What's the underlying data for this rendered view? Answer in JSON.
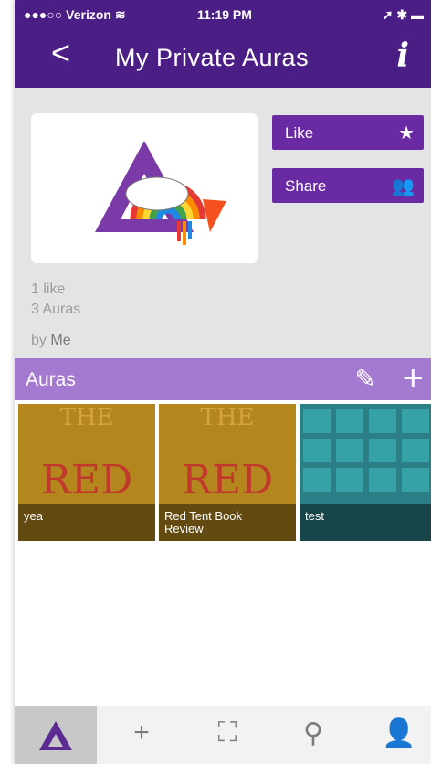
{
  "status": {
    "carrier": "●●●○○ Verizon ≋",
    "time": "11:19 PM",
    "battery": "➚ ✱ ▬"
  },
  "nav": {
    "title": "My Private Auras",
    "back_icon": "chevron-left-icon",
    "info_icon": "info-icon"
  },
  "aura": {
    "like_label": "Like",
    "share_label": "Share",
    "likes": "1 like",
    "auras_count": "3 Auras",
    "by_label": "by",
    "by_name": "Me"
  },
  "auras_section": {
    "title": "Auras"
  },
  "tiles": [
    {
      "caption": "yea"
    },
    {
      "caption": "Red Tent Book Review"
    },
    {
      "caption": "test"
    }
  ],
  "book_cover": {
    "line1": "THE",
    "line2": "RED"
  },
  "tabs": [
    "aura-logo",
    "add",
    "scan",
    "search",
    "profile"
  ],
  "colors": {
    "header": "#4b1e85",
    "button": "#6a2aa3",
    "section": "#a47ad0"
  }
}
